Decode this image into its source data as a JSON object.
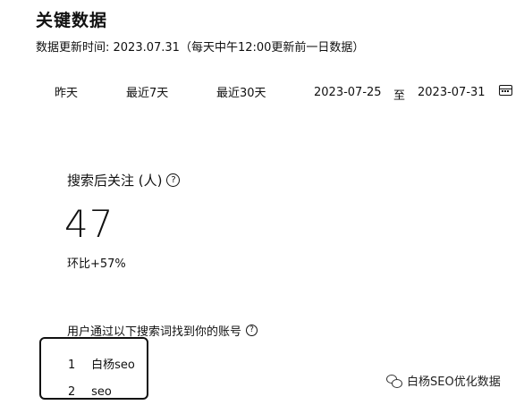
{
  "header": {
    "title": "关键数据",
    "update_text": "数据更新时间: 2023.07.31（每天中午12:00更新前一日数据）"
  },
  "range": {
    "tabs": [
      "昨天",
      "最近7天",
      "最近30天"
    ],
    "start_date": "2023-07-25",
    "separator": "至",
    "end_date": "2023-07-31",
    "calendar_icon": "calendar-icon"
  },
  "metric": {
    "label": "搜索后关注 (人)",
    "value": "47",
    "ratio": "环比+57%",
    "help_icon": "?"
  },
  "keywords": {
    "title": "用户通过以下搜索词找到你的账号",
    "help_icon": "?",
    "items": [
      {
        "index": "1",
        "term": "白杨seo"
      },
      {
        "index": "2",
        "term": "seo"
      }
    ]
  },
  "watermark": {
    "text": "白杨SEO优化数据",
    "icon": "wechat-icon"
  }
}
